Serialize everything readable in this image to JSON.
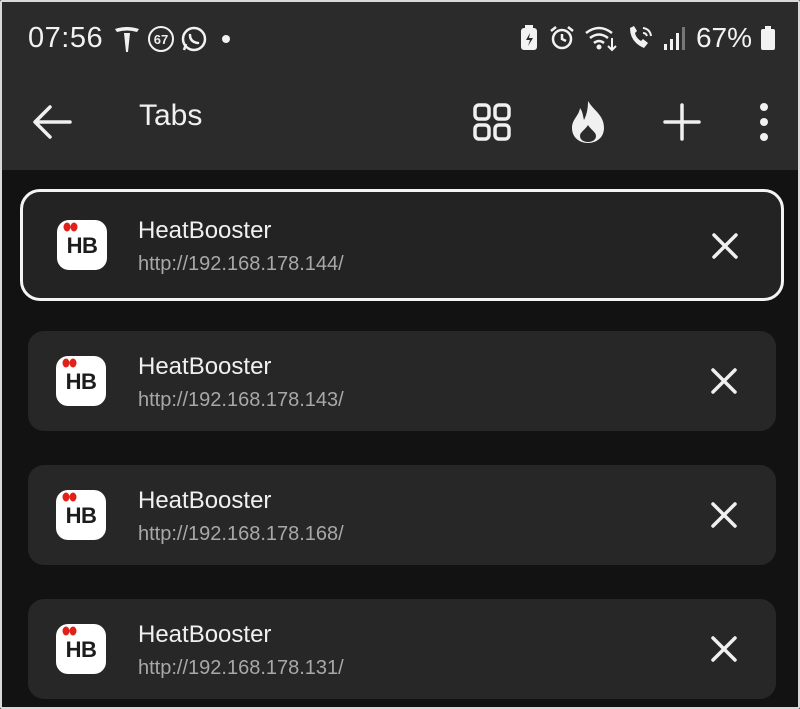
{
  "status_bar": {
    "time": "07:56",
    "left_icons": [
      "tesla-icon",
      "notification-count-icon",
      "whatsapp-icon",
      "more-notifications-dot"
    ],
    "notification_count": "67",
    "right_icons": [
      "battery-saver-icon",
      "alarm-icon",
      "wifi-calling-icon",
      "volte-icon",
      "signal-icon",
      "battery-icon"
    ],
    "battery_percent": "67%"
  },
  "app_bar": {
    "title": "Tabs",
    "icons": [
      "back-arrow-icon",
      "grid-view-icon",
      "flame-icon",
      "plus-icon",
      "more-vert-icon"
    ]
  },
  "tabs": [
    {
      "title": "HeatBooster",
      "url": "http://192.168.178.144/",
      "favicon_text": "HB",
      "selected": true
    },
    {
      "title": "HeatBooster",
      "url": "http://192.168.178.143/",
      "favicon_text": "HB",
      "selected": false
    },
    {
      "title": "HeatBooster",
      "url": "http://192.168.178.168/",
      "favicon_text": "HB",
      "selected": false
    },
    {
      "title": "HeatBooster",
      "url": "http://192.168.178.131/",
      "favicon_text": "HB",
      "selected": false
    }
  ],
  "colors": {
    "background": "#121212",
    "bar": "#2b2b2b",
    "card": "#272727",
    "selected_outline": "#f4f4f4",
    "favicon_accent": "#e0211a"
  }
}
